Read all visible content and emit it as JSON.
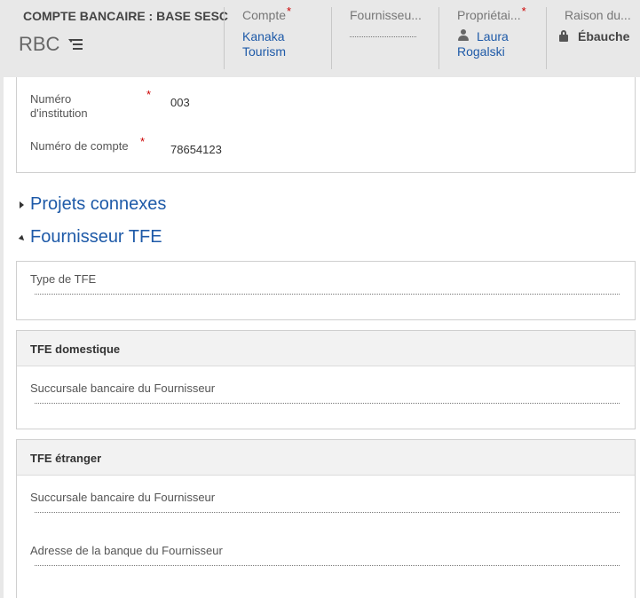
{
  "header": {
    "entity_type": "COMPTE BANCAIRE : BASE SESC",
    "record_name": "RBC",
    "fields": [
      {
        "label": "Compte",
        "required": "*",
        "value": "Kanaka Tourism"
      },
      {
        "label": "Fournisseu...",
        "required": "",
        "value": ""
      },
      {
        "label": "Propriétai...",
        "required": "*",
        "value": "Laura Rogalski"
      },
      {
        "label": "Raison du...",
        "required": "",
        "value": "Ébauche"
      }
    ]
  },
  "top_section": {
    "institution_label": "Numéro d'institution",
    "institution_required": "*",
    "institution_value": "003",
    "account_label": "Numéro de compte",
    "account_required": "*",
    "account_value": "78654123"
  },
  "sections": {
    "related_projects": "Projets connexes",
    "eft_supplier": "Fournisseur TFE"
  },
  "eft_type_box": {
    "label": "Type de TFE"
  },
  "domestic_box": {
    "title": "TFE domestique",
    "branch_label": "Succursale bancaire du Fournisseur"
  },
  "foreign_box": {
    "title": "TFE étranger",
    "branch_label": "Succursale bancaire du Fournisseur",
    "address_label": "Adresse de la banque du Fournisseur"
  },
  "colors": {
    "header_bg": "#e8e8e8",
    "link": "#1e5aa8",
    "required": "#cc0000"
  }
}
